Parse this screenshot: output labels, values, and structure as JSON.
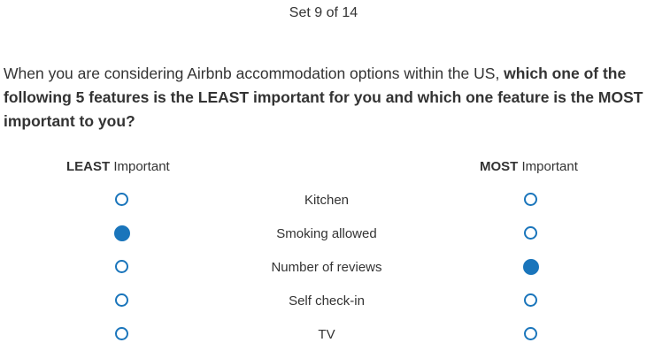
{
  "header": {
    "set_counter": "Set 9 of 14"
  },
  "question": {
    "part1": "When you are considering Airbnb accommodation options within the US, ",
    "part2_bold": "which one of the following 5 features is the LEAST important for you and which one feature is the MOST important to you?"
  },
  "columns": {
    "least_bold": "LEAST",
    "least_rest": " Important",
    "most_bold": "MOST",
    "most_rest": " Important"
  },
  "features": [
    {
      "label": "Kitchen",
      "least_selected": false,
      "most_selected": false
    },
    {
      "label": "Smoking allowed",
      "least_selected": true,
      "most_selected": false
    },
    {
      "label": "Number of reviews",
      "least_selected": false,
      "most_selected": true
    },
    {
      "label": "Self check-in",
      "least_selected": false,
      "most_selected": false
    },
    {
      "label": "TV",
      "least_selected": false,
      "most_selected": false
    }
  ],
  "colors": {
    "accent": "#1a75bb",
    "text": "#333333"
  }
}
